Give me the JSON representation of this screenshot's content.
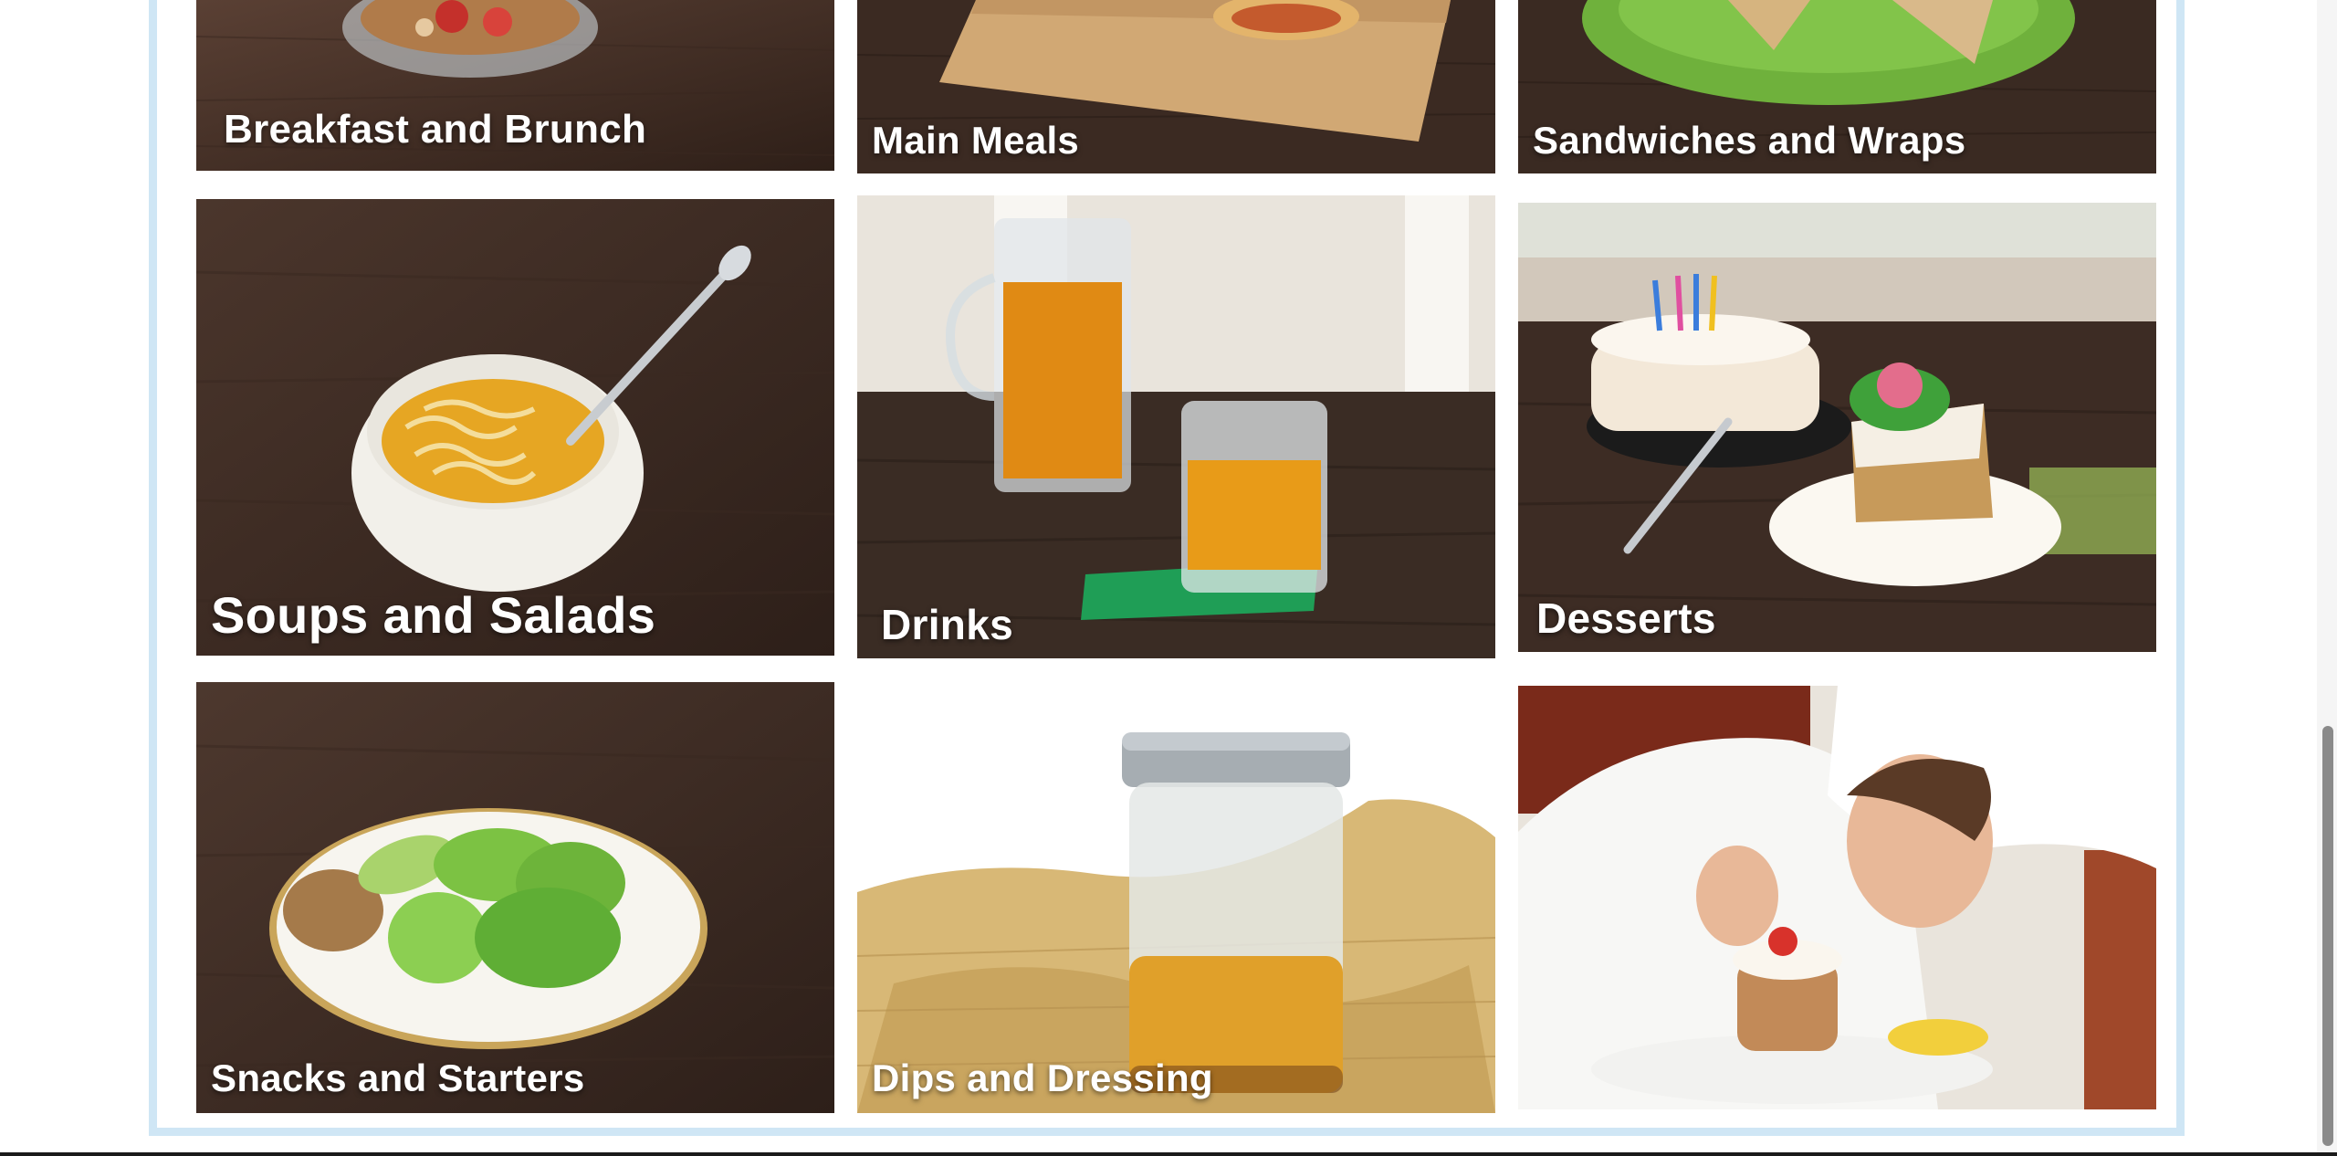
{
  "categories": [
    {
      "label": "Breakfast and Brunch",
      "icon": "cereal-bowl-photo"
    },
    {
      "label": "Main Meals",
      "icon": "pizza-board-photo"
    },
    {
      "label": "Sandwiches and Wraps",
      "icon": "sandwich-plate-photo"
    },
    {
      "label": "Soups and Salads",
      "icon": "noodle-soup-photo"
    },
    {
      "label": "Drinks",
      "icon": "orange-juice-photo"
    },
    {
      "label": "Desserts",
      "icon": "birthday-cake-photo"
    },
    {
      "label": "Snacks and Starters",
      "icon": "apple-slices-photo"
    },
    {
      "label": "Dips and Dressing",
      "icon": "dressing-jar-photo"
    },
    {
      "label": "",
      "icon": "chef-plating-photo"
    }
  ],
  "colors": {
    "frame": "#cfe6f5",
    "label_text": "#ffffff",
    "wood": "#4a3328"
  }
}
